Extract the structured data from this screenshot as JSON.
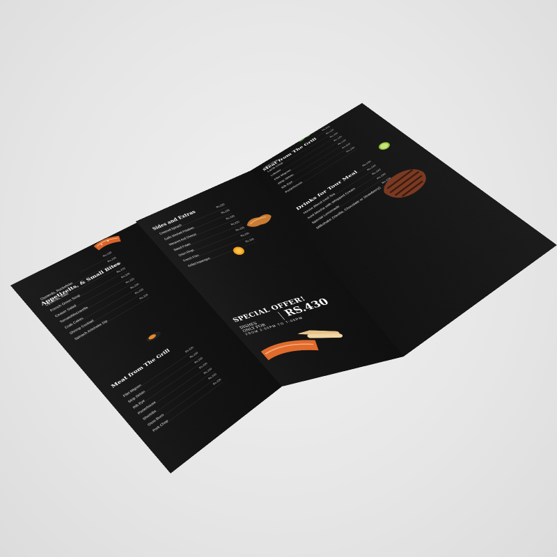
{
  "colors": {
    "paper": "#141414",
    "background": "#e4e4e4",
    "text": "#ffffff",
    "accent_food": "#e0782a"
  },
  "left_panel": {
    "section1": {
      "title": "Appetizelts, & Small Bites",
      "items": [
        {
          "name": "",
          "price": "Rs.220"
        },
        {
          "name": "Oysterds, Rockefeler",
          "price": "Rs.220"
        },
        {
          "name": "Oysterds, Raw",
          "price": "Rs.220"
        },
        {
          "name": "French Onion Soup",
          "price": "Rs.220"
        },
        {
          "name": "Ceaser Salad",
          "price": "Rs.220"
        },
        {
          "name": "TomatoMozzarella",
          "price": "Rs.220"
        },
        {
          "name": "Crab Cakes",
          "price": "Rs.220"
        },
        {
          "name": "Shrimp Cocktail",
          "price": "Rs.220"
        },
        {
          "name": "Spinach Artichoke Dip",
          "price": "Rs.220"
        }
      ]
    },
    "section2": {
      "title": "Meat from The Grill",
      "items": [
        {
          "name": "Filet Mignon",
          "price": "Rs.220"
        },
        {
          "name": "Strip Sirloin",
          "price": "Rs.220"
        },
        {
          "name": "Rib Eye",
          "price": "Rs.220"
        },
        {
          "name": "Porterhouse",
          "price": "Rs.220"
        },
        {
          "name": "Shortribs",
          "price": "Rs.220"
        },
        {
          "name": "Osso Buco",
          "price": "Rs.220"
        },
        {
          "name": "Pork Chop",
          "price": "Rs.220"
        }
      ]
    }
  },
  "middle_panel": {
    "section1": {
      "title": "Sides and Extras",
      "items": [
        {
          "name": "Creamed Spinach",
          "price": "Rs.220"
        },
        {
          "name": "Garlic Mashed Potatoes",
          "price": "Rs.220"
        },
        {
          "name": "Macaroni And Cheese",
          "price": "Rs.220"
        },
        {
          "name": "Baked Potato",
          "price": "Rs.220"
        },
        {
          "name": "Onion Rings",
          "price": "Rs.220"
        },
        {
          "name": "French Fries",
          "price": "Rs.220"
        },
        {
          "name": "Grilled Asparagus",
          "price": "Rs.220"
        }
      ]
    },
    "offer": {
      "heading": "SPECIAL OFFER!",
      "line1": "DISHES",
      "line2": "ONLY FOR",
      "price": "RS.430",
      "time": "FROM 2:00PM TO 7:00PM"
    }
  },
  "right_panel": {
    "section1": {
      "title": "Meat from The Grill",
      "items": [
        {
          "name": "",
          "price": "Rs.220"
        },
        {
          "name": "Veal Chop",
          "price": "Rs.220"
        },
        {
          "name": "Lamb Chop",
          "price": "Rs.220"
        },
        {
          "name": "Lobster",
          "price": "Rs.220"
        },
        {
          "name": "Filet Mignon",
          "price": "Rs.220"
        },
        {
          "name": "Strip Sirloin",
          "price": "Rs.220"
        },
        {
          "name": "Rib Eye",
          "price": "Rs.220"
        },
        {
          "name": "Porterhouse",
          "price": "Rs.220"
        }
      ]
    },
    "section2": {
      "title": "Drinks for Tour Meal",
      "items": [
        {
          "name": "",
          "price": "Rs.220"
        },
        {
          "name": "House Blend Iced Tea",
          "price": "Rs.220"
        },
        {
          "name": "Iced Mocha with Whipped Cream",
          "price": "Rs.220"
        },
        {
          "name": "Special Lemonade",
          "price": "Rs.220"
        },
        {
          "name": "Milkshake (Vanilla, Chocolate or Strawberry)",
          "price": "Rs.220"
        }
      ]
    }
  }
}
